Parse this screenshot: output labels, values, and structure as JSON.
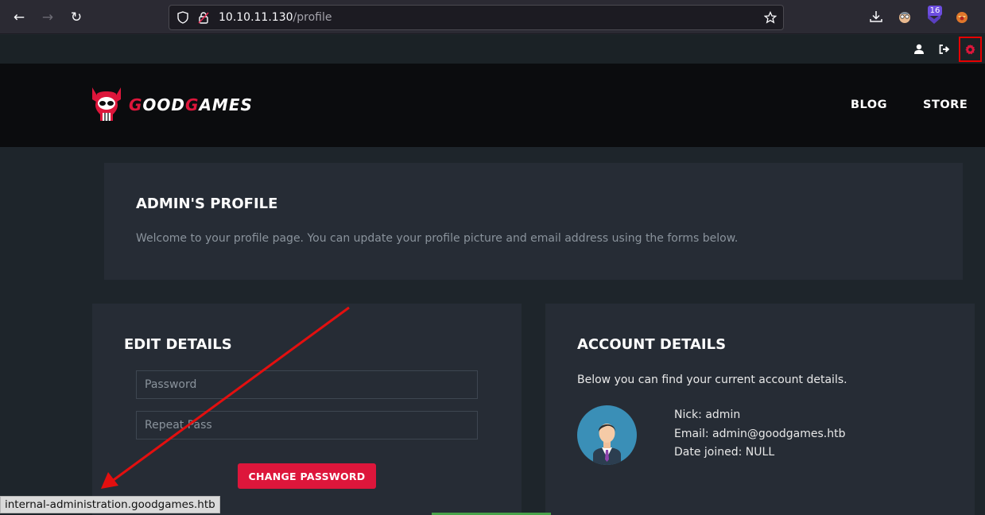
{
  "browser": {
    "url_host": "10.10.11.130",
    "url_path": "/profile",
    "extension_badge": "16",
    "icons": [
      "back-icon",
      "forward-icon",
      "reload-icon",
      "shield-icon",
      "lock-icon",
      "star-icon",
      "download-icon"
    ]
  },
  "topbar": {
    "icons": [
      "user-icon",
      "logout-icon",
      "gear-icon"
    ],
    "highlight_color": "#e60000"
  },
  "header": {
    "logo_prefix": "G",
    "logo_mid": "OOD",
    "logo_g2": "G",
    "logo_suffix": "AMES",
    "nav": [
      "BLOG",
      "STORE"
    ],
    "brand_color": "#dd163b"
  },
  "profile": {
    "title": "ADMIN'S PROFILE",
    "welcome": "Welcome to your profile page. You can update your profile picture and email address using the forms below."
  },
  "edit": {
    "title": "EDIT DETAILS",
    "password_placeholder": "Password",
    "repeat_placeholder": "Repeat Pass",
    "button": "CHANGE PASSWORD"
  },
  "account": {
    "title": "ACCOUNT DETAILS",
    "intro": "Below you can find your current account details.",
    "nick": "Nick: admin",
    "email": "Email: admin@goodgames.htb",
    "joined": "Date joined: NULL"
  },
  "status_bar": "internal-administration.goodgames.htb",
  "annotation": {
    "arrow_color": "#e30f0f"
  }
}
